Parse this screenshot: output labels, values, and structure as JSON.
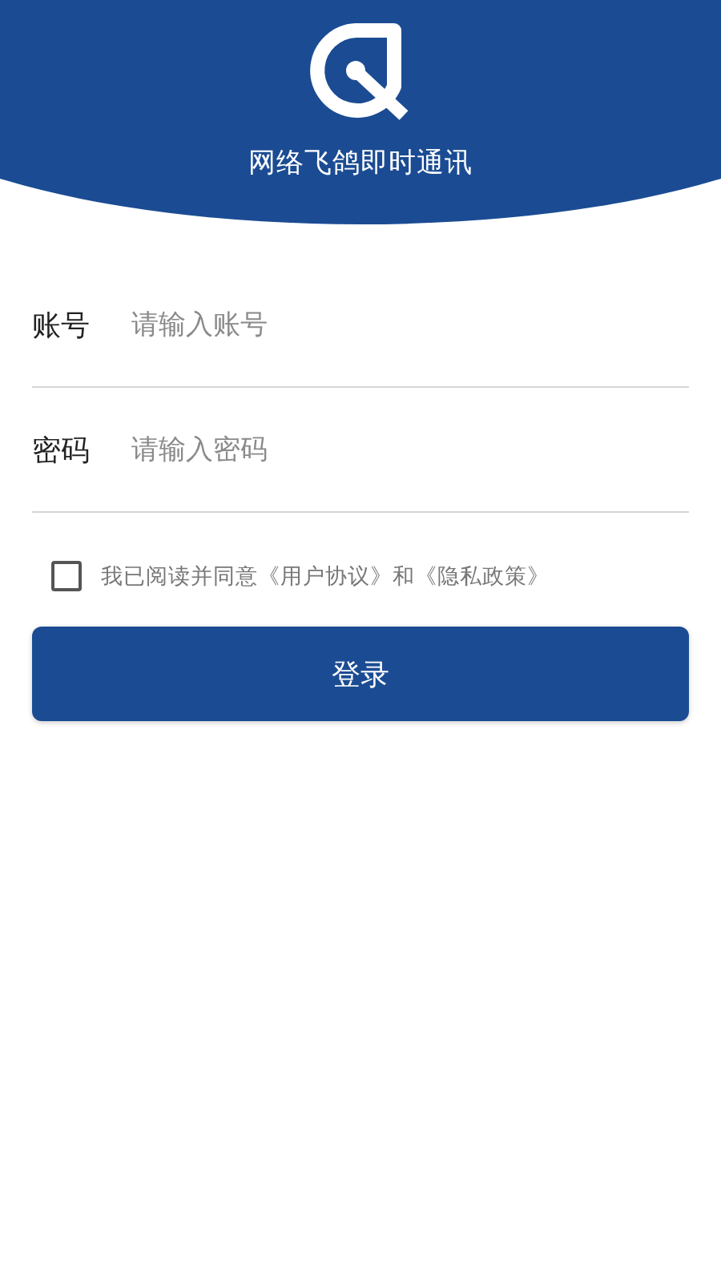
{
  "header": {
    "title": "网络飞鸽即时通讯"
  },
  "fields": [
    {
      "label": "账号",
      "placeholder": "请输入账号"
    },
    {
      "label": "密码",
      "placeholder": "请输入密码"
    }
  ],
  "agreement": {
    "checked": false,
    "text": "我已阅读并同意《用户协议》和《隐私政策》"
  },
  "login_button": {
    "label": "登录"
  }
}
